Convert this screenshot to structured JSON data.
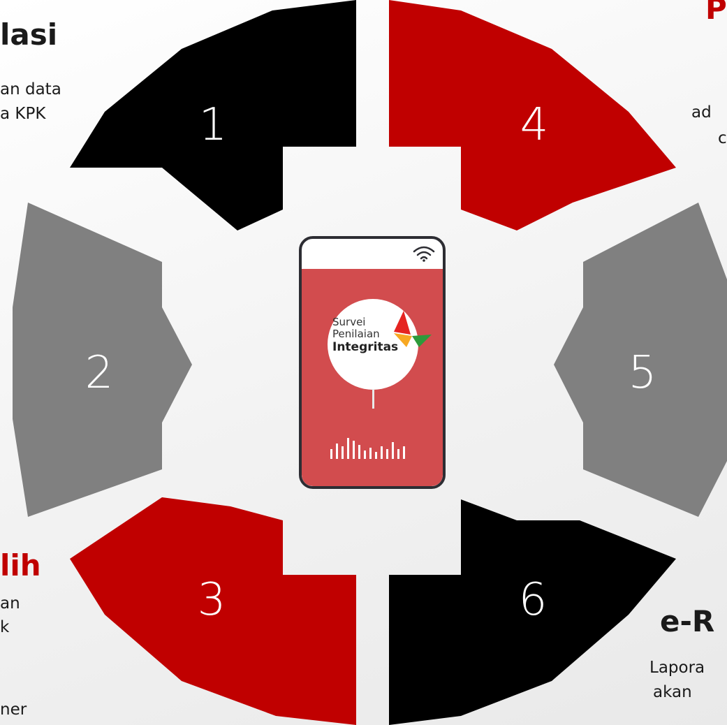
{
  "segments": [
    {
      "number": "1",
      "color": "#000000"
    },
    {
      "number": "2",
      "color": "#808080"
    },
    {
      "number": "3",
      "color": "#c00000"
    },
    {
      "number": "4",
      "color": "#c00000"
    },
    {
      "number": "5",
      "color": "#808080"
    },
    {
      "number": "6",
      "color": "#000000"
    }
  ],
  "labels": {
    "step1_title": "lasi",
    "step1_text_line1": "an data",
    "step1_text_line2": "a KPK",
    "step3_title": "lih",
    "step3_text_line1": "an",
    "step3_text_line2": "k",
    "step3_text_line3": "ner",
    "step4_title": "P",
    "step4_text_line1": "ad",
    "step4_text_line2": "c",
    "step6_title": "e-R",
    "step6_text_line1": "Lapora",
    "step6_text_line2": "akan"
  },
  "phone": {
    "logo_line1": "Survei",
    "logo_line2": "Penilaian",
    "logo_line3": "Integritas",
    "logo_colors": [
      "#e52421",
      "#f7a823",
      "#2e9a3b"
    ]
  },
  "colors": {
    "red": "#c00000",
    "gray": "#808080",
    "black": "#000000",
    "phone_screen": "#d24c4e"
  }
}
